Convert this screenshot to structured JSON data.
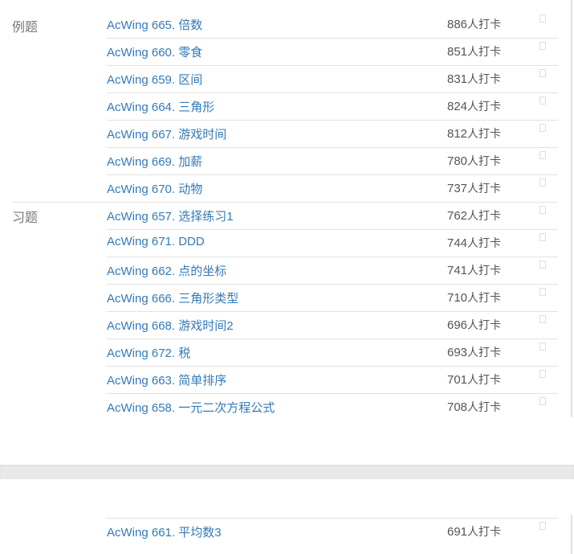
{
  "sections": [
    {
      "label": "例题",
      "items": [
        {
          "code": "AcWing 665.",
          "name": "倍数",
          "count": "886",
          "suffix": "人打卡"
        },
        {
          "code": "AcWing 660.",
          "name": "零食",
          "count": "851",
          "suffix": "人打卡"
        },
        {
          "code": "AcWing 659.",
          "name": "区间",
          "count": "831",
          "suffix": "人打卡"
        },
        {
          "code": "AcWing 664.",
          "name": "三角形",
          "count": "824",
          "suffix": "人打卡"
        },
        {
          "code": "AcWing 667.",
          "name": "游戏时间",
          "count": "812",
          "suffix": "人打卡"
        },
        {
          "code": "AcWing 669.",
          "name": "加薪",
          "count": "780",
          "suffix": "人打卡"
        },
        {
          "code": "AcWing 670.",
          "name": "动物",
          "count": "737",
          "suffix": "人打卡"
        }
      ]
    },
    {
      "label": "习题",
      "items": [
        {
          "code": "AcWing 657.",
          "name": "选择练习1",
          "count": "762",
          "suffix": "人打卡"
        },
        {
          "code": "AcWing 671.",
          "name": "DDD",
          "count": "744",
          "suffix": "人打卡"
        },
        {
          "code": "AcWing 662.",
          "name": "点的坐标",
          "count": "741",
          "suffix": "人打卡"
        },
        {
          "code": "AcWing 666.",
          "name": "三角形类型",
          "count": "710",
          "suffix": "人打卡"
        },
        {
          "code": "AcWing 668.",
          "name": "游戏时间2",
          "count": "696",
          "suffix": "人打卡"
        },
        {
          "code": "AcWing 672.",
          "name": "税",
          "count": "693",
          "suffix": "人打卡"
        },
        {
          "code": "AcWing 663.",
          "name": "简单排序",
          "count": "701",
          "suffix": "人打卡"
        },
        {
          "code": "AcWing 658.",
          "name": "一元二次方程公式",
          "count": "708",
          "suffix": "人打卡"
        }
      ]
    }
  ],
  "bottom_items": [
    {
      "code": "AcWing 661.",
      "name": "平均数3",
      "count": "691",
      "suffix": "人打卡"
    }
  ]
}
